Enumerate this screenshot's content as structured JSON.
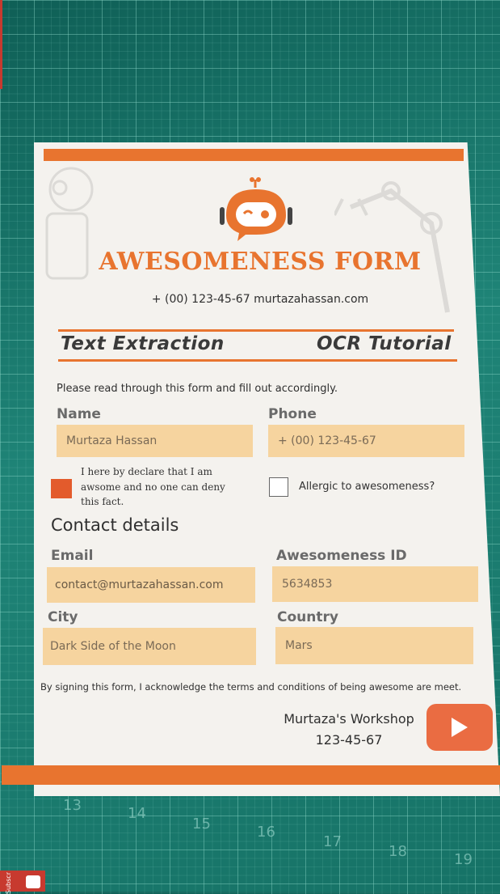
{
  "form": {
    "title": "AWESOMENESS FORM",
    "contact_line": "+ (00) 123-45-67 murtazahassan.com",
    "section_left": "Text Extraction",
    "section_right": "OCR Tutorial",
    "instruction": "Please read through this form and fill out accordingly.",
    "fields": {
      "name_label": "Name",
      "name_value": "Murtaza Hassan",
      "phone_label": "Phone",
      "phone_value": "+ (00) 123-45-67",
      "email_label": "Email",
      "email_value": "contact@murtazahassan.com",
      "id_label": "Awesomeness ID",
      "id_value": "5634853",
      "city_label": "City",
      "city_value": "Dark Side of the Moon",
      "country_label": "Country",
      "country_value": "Mars"
    },
    "declare_checkbox": {
      "checked": true,
      "lines": [
        "I here by declare that I am",
        "awsome and no one can deny",
        "this fact."
      ]
    },
    "allergic_checkbox": {
      "checked": false,
      "label": "Allergic to awesomeness?"
    },
    "contact_heading": "Contact details",
    "footer_note": "By signing this form, I acknowledge the terms and conditions of being awesome are meet.",
    "workshop_name": "Murtaza's Workshop",
    "workshop_phone": "123-45-67",
    "colors": {
      "accent": "#e8742f",
      "field_fill": "#f6d49f",
      "checkbox_fill": "#e35b2c",
      "mat": "#1b7a6f"
    },
    "icons": [
      "robot-logo-icon",
      "play-button-icon"
    ]
  },
  "mat": {
    "numbers": [
      "13",
      "14",
      "15",
      "16",
      "17",
      "18",
      "19"
    ]
  },
  "overlay": {
    "subscribe": "Subscr"
  }
}
